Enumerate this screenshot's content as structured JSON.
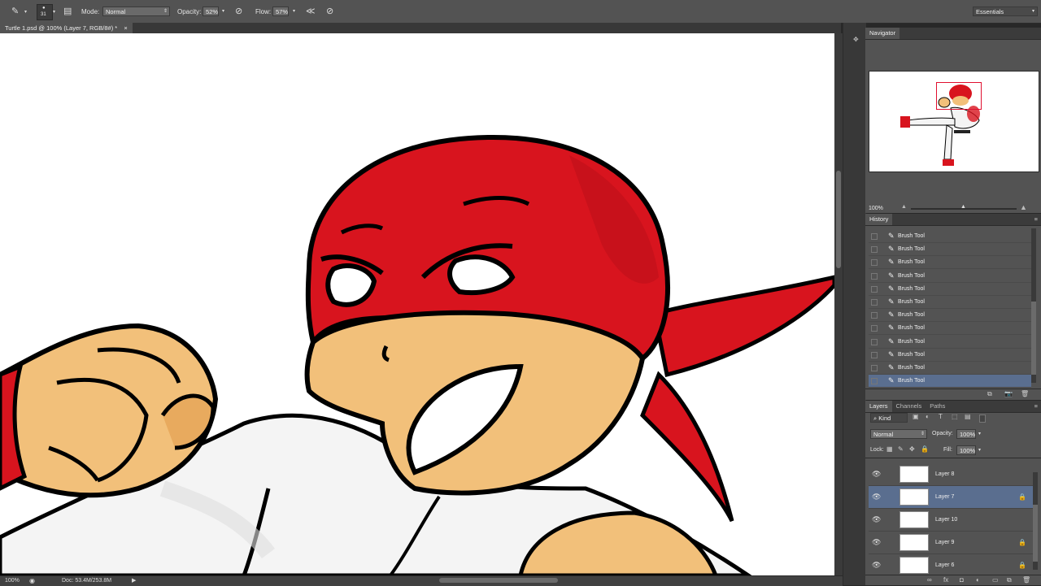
{
  "options_bar": {
    "brush_size": "31",
    "mode_label": "Mode:",
    "mode_value": "Normal",
    "opacity_label": "Opacity:",
    "opacity_value": "52%",
    "flow_label": "Flow:",
    "flow_value": "57%",
    "workspace": "Essentials"
  },
  "document_tab": {
    "title": "Turtle 1.psd @ 100% (Layer 7, RGB/8#) *",
    "close": "×"
  },
  "status_bar": {
    "zoom": "100%",
    "doc_info": "Doc: 53.4M/253.8M"
  },
  "navigator": {
    "title": "Navigator",
    "zoom": "100%"
  },
  "history": {
    "title": "History",
    "items": [
      "Brush Tool",
      "Brush Tool",
      "Brush Tool",
      "Brush Tool",
      "Brush Tool",
      "Brush Tool",
      "Brush Tool",
      "Brush Tool",
      "Brush Tool",
      "Brush Tool",
      "Brush Tool",
      "Brush Tool"
    ],
    "selected_index": 11
  },
  "layers": {
    "tabs": [
      "Layers",
      "Channels",
      "Paths"
    ],
    "kind_label": "Kind",
    "blend_mode": "Normal",
    "opacity_label": "Opacity:",
    "opacity_value": "100%",
    "lock_label": "Lock:",
    "fill_label": "Fill:",
    "fill_value": "100%",
    "items": [
      {
        "name": "Layer 8",
        "locked": false
      },
      {
        "name": "Layer 7",
        "locked": true
      },
      {
        "name": "Layer 10",
        "locked": false
      },
      {
        "name": "Layer 9",
        "locked": true
      },
      {
        "name": "Layer 6",
        "locked": true
      }
    ],
    "selected_index": 1
  },
  "colors": {
    "foreground": "#8b0000",
    "background": "#f0a020",
    "bandana_red": "#d8141e",
    "skin": "#f2c07a",
    "selection": "#5a6e8f"
  }
}
